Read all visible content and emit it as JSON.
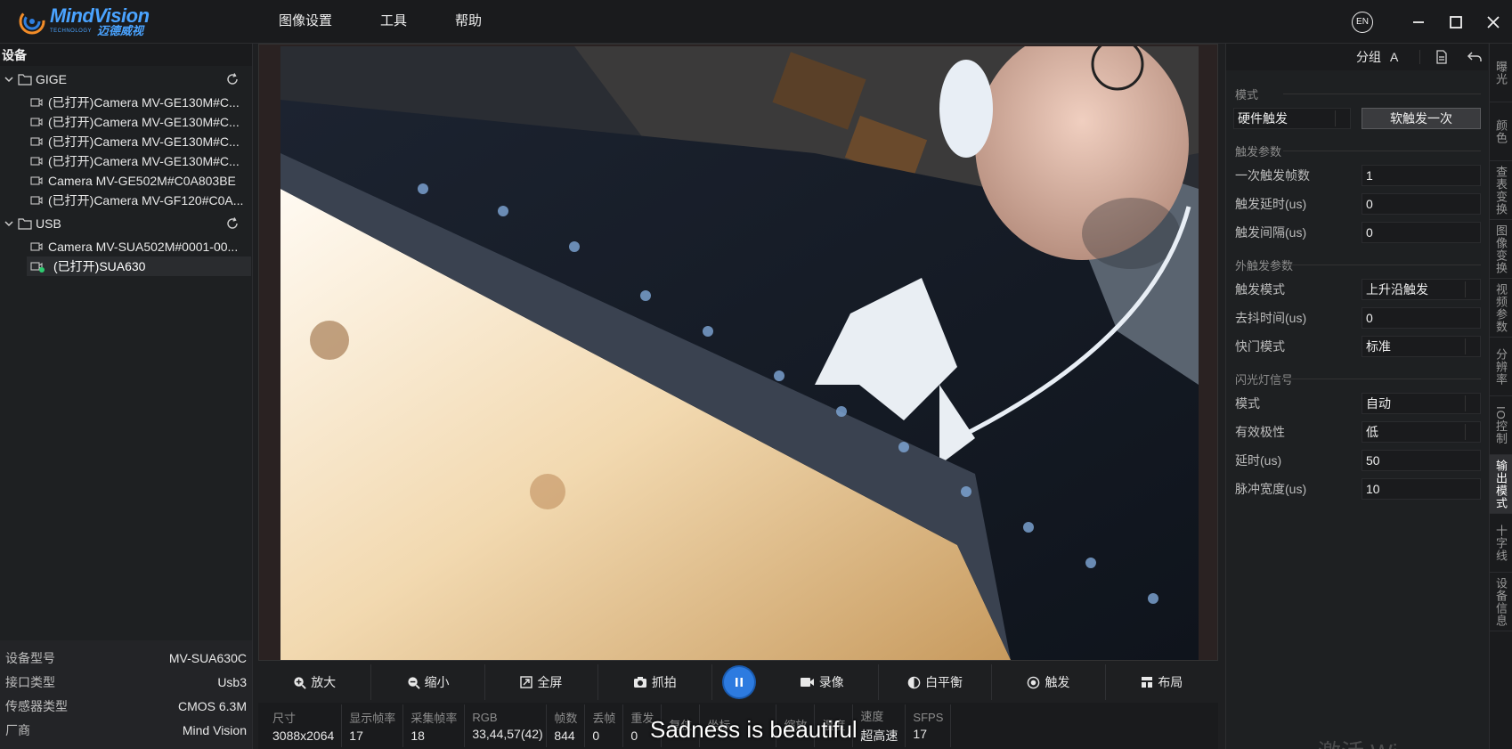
{
  "app": {
    "brand": "MindVision",
    "brand_sub": "TECHNOLOGY",
    "brand_cn": "迈德威视"
  },
  "menu": [
    "图像设置",
    "工具",
    "帮助"
  ],
  "window_controls": {
    "lang": "EN"
  },
  "devices": {
    "header": "设备",
    "groups": [
      {
        "name": "GIGE",
        "items": [
          "(已打开)Camera MV-GE130M#C...",
          "(已打开)Camera MV-GE130M#C...",
          "(已打开)Camera MV-GE130M#C...",
          "(已打开)Camera MV-GE130M#C...",
          "Camera MV-GE502M#C0A803BE",
          "(已打开)Camera MV-GF120#C0A..."
        ]
      },
      {
        "name": "USB",
        "items": [
          "Camera MV-SUA502M#0001-00...",
          "(已打开)SUA630"
        ]
      }
    ]
  },
  "device_info": [
    {
      "key": "设备型号",
      "value": "MV-SUA630C"
    },
    {
      "key": "接口类型",
      "value": "Usb3"
    },
    {
      "key": "传感器类型",
      "value": "CMOS 6.3M"
    },
    {
      "key": "厂商",
      "value": "Mind Vision"
    }
  ],
  "toolbar": {
    "zoom_in": "放大",
    "zoom_out": "缩小",
    "fullscreen": "全屏",
    "snapshot": "抓拍",
    "record": "录像",
    "white_balance": "白平衡",
    "trigger": "触发",
    "layout": "布局"
  },
  "status": [
    {
      "h": "尺寸",
      "v": "3088x2064"
    },
    {
      "h": "显示帧率",
      "v": "17"
    },
    {
      "h": "采集帧率",
      "v": "18"
    },
    {
      "h": "RGB",
      "v": "33,44,57(42)"
    },
    {
      "h": "帧数",
      "v": "844"
    },
    {
      "h": "丢帧",
      "v": "0"
    },
    {
      "h": "重发",
      "v": "0"
    },
    {
      "h": "复位",
      "v": ""
    },
    {
      "h": "坐标",
      "v": ""
    },
    {
      "h": "缩放",
      "v": ""
    },
    {
      "h": "温度",
      "v": ""
    },
    {
      "h": "速度",
      "v": "超高速"
    },
    {
      "h": "SFPS",
      "v": "17"
    }
  ],
  "subtitle": "Sadness is beautiful",
  "right": {
    "group_label": "分组",
    "group_value": "A",
    "mode_section": "模式",
    "mode_value": "硬件触发",
    "soft_trigger_btn": "软触发一次",
    "trigger_section": "触发参数",
    "trigger_params": [
      {
        "key": "一次触发帧数",
        "value": "1"
      },
      {
        "key": "触发延时(us)",
        "value": "0"
      },
      {
        "key": "触发间隔(us)",
        "value": "0"
      }
    ],
    "ext_section": "外触发参数",
    "ext_params": [
      {
        "key": "触发模式",
        "value": "上升沿触发",
        "dropdown": true
      },
      {
        "key": "去抖时间(us)",
        "value": "0",
        "dropdown": false
      },
      {
        "key": "快门模式",
        "value": "标准",
        "dropdown": true
      }
    ],
    "flash_section": "闪光灯信号",
    "flash_params": [
      {
        "key": "模式",
        "value": "自动",
        "dropdown": true
      },
      {
        "key": "有效极性",
        "value": "低",
        "dropdown": true
      },
      {
        "key": "延时(us)",
        "value": "50",
        "dropdown": false
      },
      {
        "key": "脉冲宽度(us)",
        "value": "10",
        "dropdown": false
      }
    ]
  },
  "vtabs": [
    "曝光",
    "颜色",
    "查表变换",
    "图像变换",
    "视频参数",
    "分辨率",
    "IO控制",
    "输出模式",
    "十字线",
    "设备信息"
  ],
  "vtab_active": 7,
  "watermark": "激活 Wi..."
}
